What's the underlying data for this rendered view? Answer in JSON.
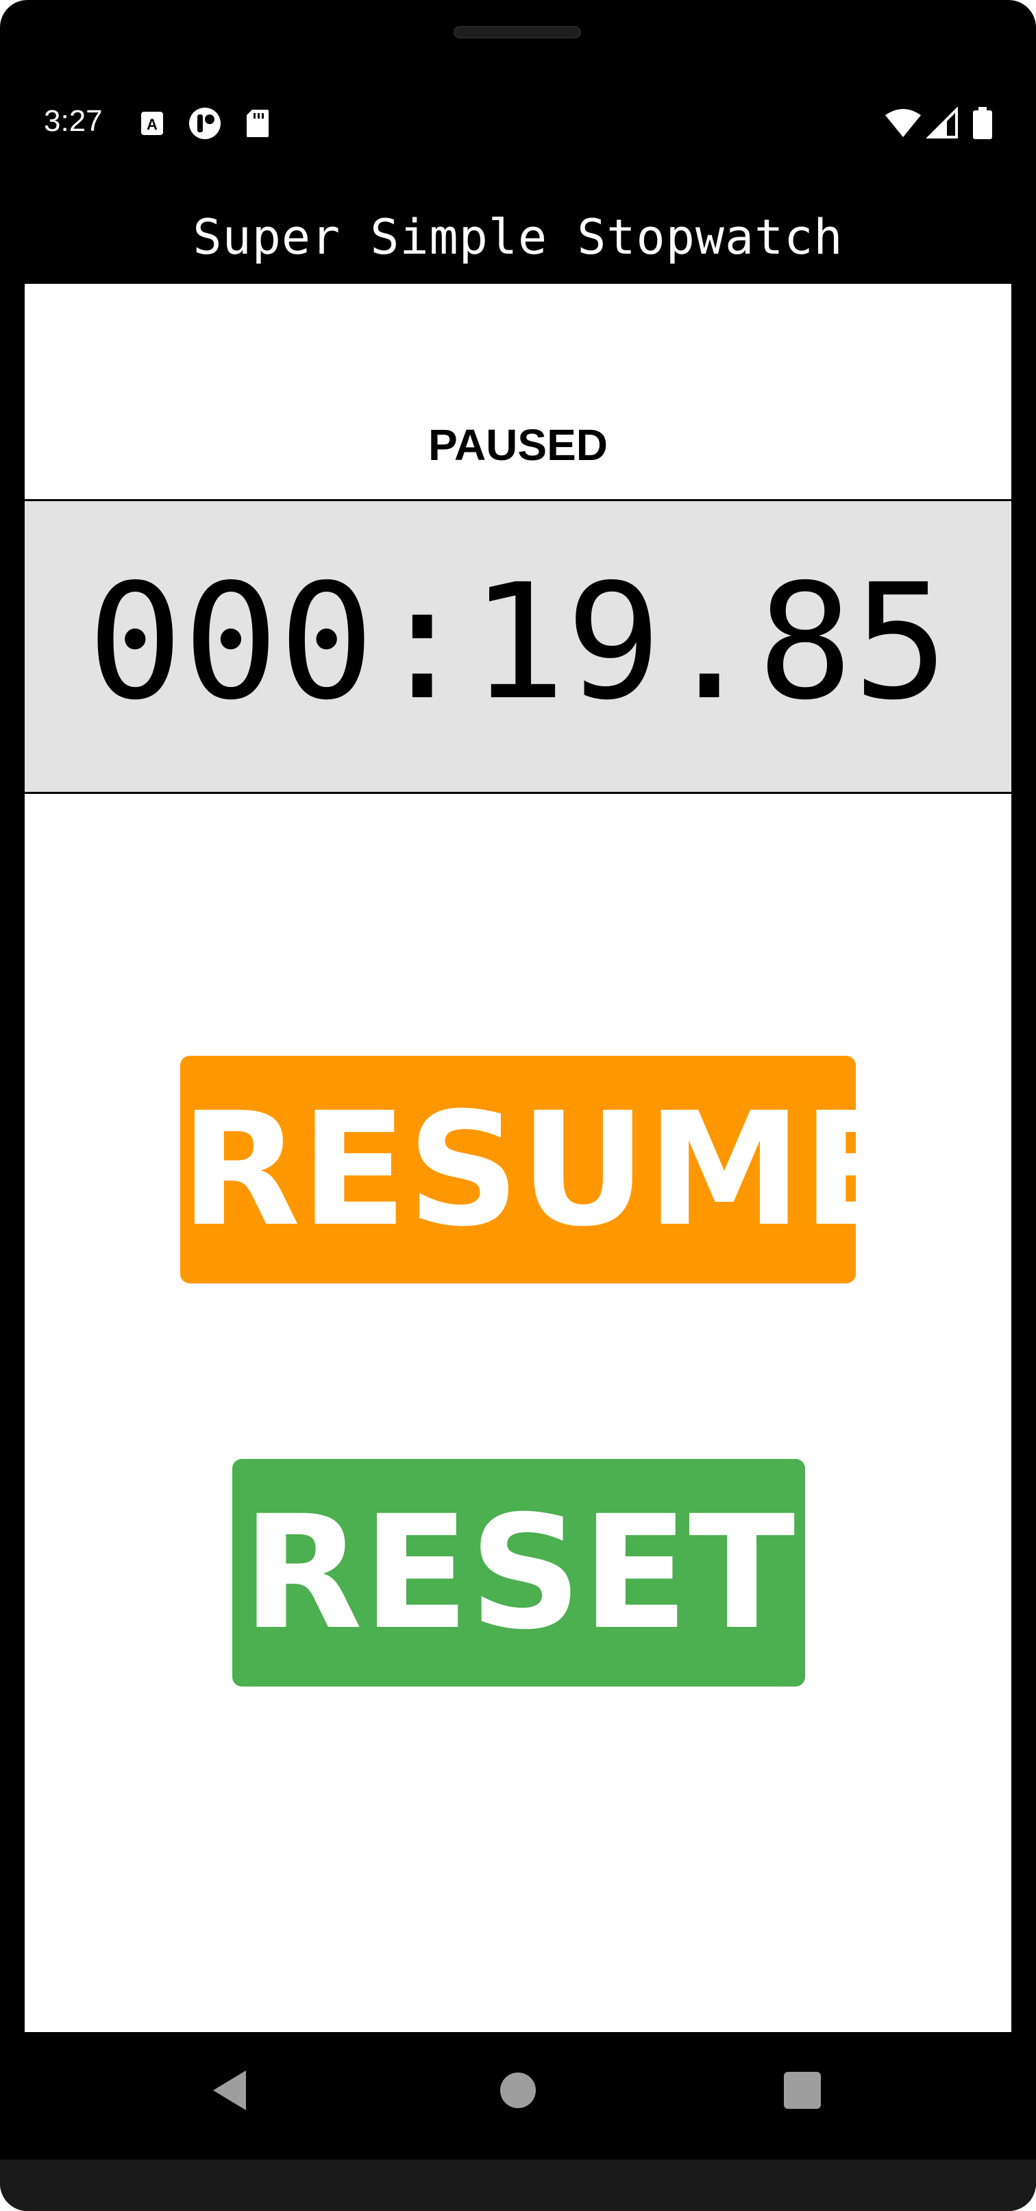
{
  "status_bar": {
    "time": "3:27",
    "left_icons": [
      "translate-icon",
      "accessibility-icon",
      "sd-card-icon"
    ],
    "right_icons": [
      "wifi-icon",
      "signal-icon",
      "battery-icon"
    ]
  },
  "app": {
    "title": "Super Simple Stopwatch"
  },
  "stopwatch": {
    "state_label": "PAUSED",
    "elapsed": "000:19.85"
  },
  "buttons": {
    "resume_label": "RESUME",
    "reset_label": "RESET"
  },
  "navigation": {
    "buttons": [
      "back-icon",
      "home-icon",
      "recents-icon"
    ]
  },
  "colors": {
    "resume": "#ff9800",
    "reset": "#4caf50",
    "time_panel_bg": "#e3e3e3",
    "frame": "#000000"
  }
}
